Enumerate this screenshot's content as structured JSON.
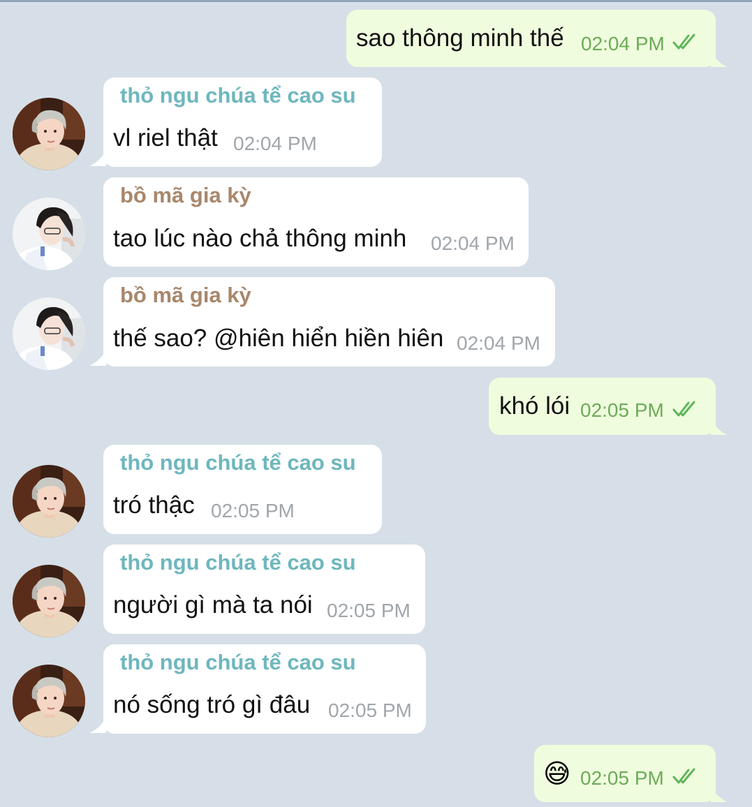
{
  "colors": {
    "background": "#d6dfe7",
    "incoming_bubble": "#ffffff",
    "outgoing_bubble": "#effdde",
    "outgoing_time": "#6dab58",
    "incoming_time": "#a0a6ab",
    "sender_teal": "#6eb7bd",
    "sender_brown": "#a8876b"
  },
  "messages": [
    {
      "text": "sao thông minh thế",
      "time": "02:04 PM",
      "status_icon": "double-check-icon"
    },
    {
      "sender": "thỏ ngu chúa tể cao su",
      "text": "vl riel thật",
      "time": "02:04 PM",
      "avatar": "avatar-thao-icon"
    },
    {
      "sender": "bồ mã gia kỳ",
      "text": "tao lúc nào chả thông minh",
      "time": "02:04 PM",
      "avatar": "avatar-bo-icon"
    },
    {
      "sender": "bồ mã gia kỳ",
      "text": "thế sao? @hiên hiển hiền hiên",
      "time": "02:04 PM",
      "avatar": "avatar-bo-icon"
    },
    {
      "text": "khó lói",
      "time": "02:05 PM",
      "status_icon": "double-check-icon"
    },
    {
      "sender": "thỏ ngu chúa tể cao su",
      "text": "tró thậc",
      "time": "02:05 PM",
      "avatar": "avatar-thao-icon"
    },
    {
      "sender": "thỏ ngu chúa tể cao su",
      "text": "người gì mà ta nói",
      "time": "02:05 PM",
      "avatar": "avatar-thao-icon"
    },
    {
      "sender": "thỏ ngu chúa tể cao su",
      "text": "nó sống tró gì đâu",
      "time": "02:05 PM",
      "avatar": "avatar-thao-icon"
    },
    {
      "text": "😅",
      "time": "02:05 PM",
      "status_icon": "double-check-icon"
    }
  ]
}
